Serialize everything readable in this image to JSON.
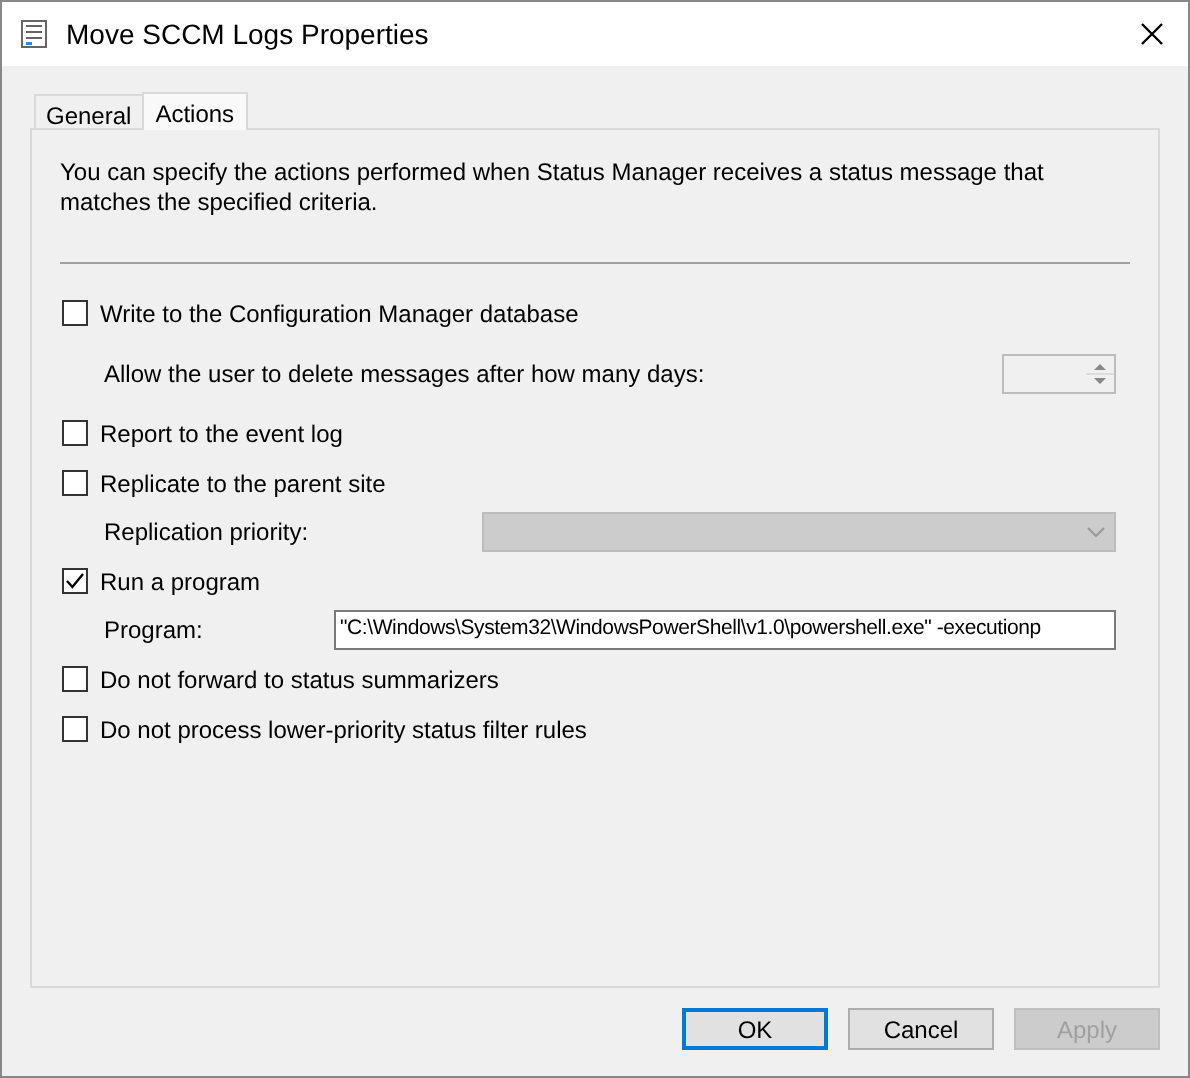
{
  "window": {
    "title": "Move SCCM Logs Properties"
  },
  "tabs": [
    {
      "label": "General",
      "selected": false
    },
    {
      "label": "Actions",
      "selected": true
    }
  ],
  "description": "You can specify the actions performed when Status Manager receives a status message that matches the specified criteria.",
  "options": [
    {
      "kind": "checkbox",
      "label": "Write to the Configuration Manager database",
      "checked": false
    },
    {
      "kind": "spinner",
      "label": "Allow the user to delete messages after how many days:",
      "disabled": true
    },
    {
      "kind": "checkbox",
      "label": "Report to the event log",
      "checked": false
    },
    {
      "kind": "checkbox",
      "label": "Replicate to the parent site",
      "checked": false
    },
    {
      "kind": "dropdown",
      "label": "Replication priority:",
      "disabled": true
    },
    {
      "kind": "checkbox",
      "label": "Run a program",
      "checked": true
    },
    {
      "kind": "text",
      "label": "Program:",
      "value": "\"C:\\Windows\\System32\\WindowsPowerShell\\v1.0\\powershell.exe\" -executionp"
    },
    {
      "kind": "checkbox",
      "label": "Do not forward to status summarizers",
      "checked": false
    },
    {
      "kind": "checkbox",
      "label": "Do not process lower-priority status filter rules",
      "checked": false
    }
  ],
  "buttons": [
    {
      "label": "OK",
      "default": true,
      "disabled": false
    },
    {
      "label": "Cancel",
      "default": false,
      "disabled": false
    },
    {
      "label": "Apply",
      "default": false,
      "disabled": true
    }
  ]
}
